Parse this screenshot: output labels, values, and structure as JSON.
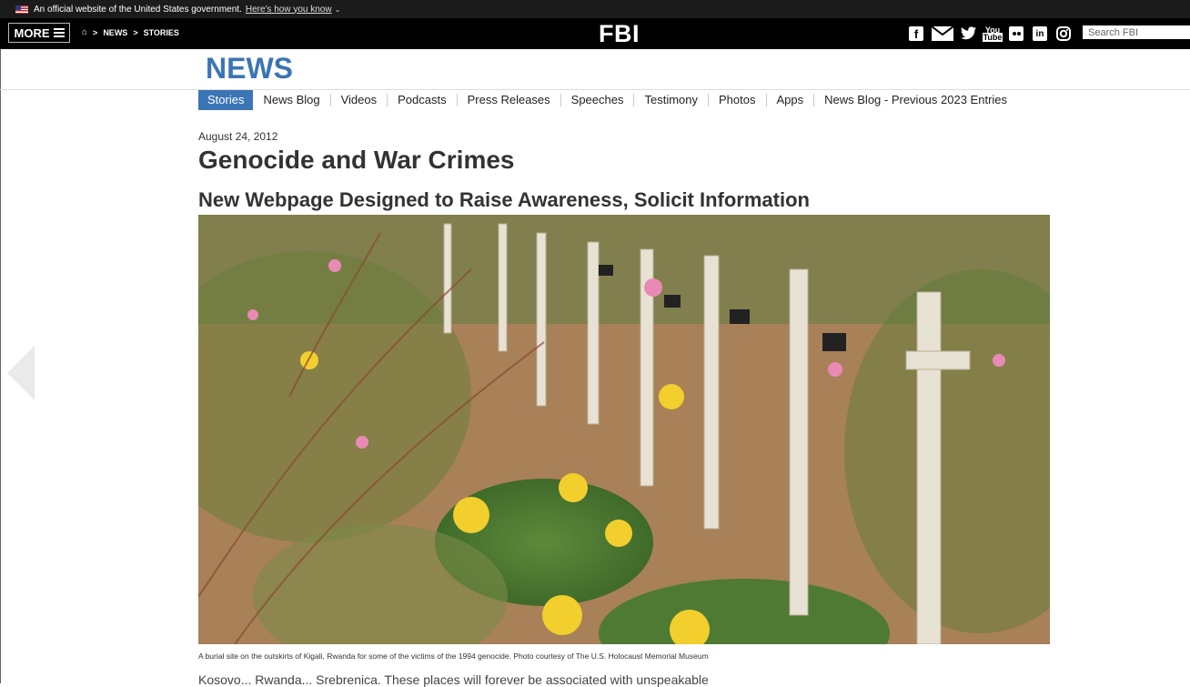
{
  "gov_banner": {
    "text": "An official website of the United States government.",
    "link": "Here's how you know"
  },
  "topbar": {
    "more_label": "MORE",
    "breadcrumb": [
      "NEWS",
      "STORIES"
    ],
    "logo": "FBI",
    "social_icons": [
      "facebook-icon",
      "email-icon",
      "twitter-icon",
      "youtube-icon",
      "flickr-icon",
      "linkedin-icon",
      "instagram-icon"
    ],
    "search_placeholder": "Search FBI"
  },
  "section": {
    "title": "NEWS"
  },
  "subnav": {
    "tabs": [
      "Stories",
      "News Blog",
      "Videos",
      "Podcasts",
      "Press Releases",
      "Speeches",
      "Testimony",
      "Photos",
      "Apps",
      "News Blog - Previous 2023 Entries"
    ],
    "active": "Stories"
  },
  "article": {
    "date": "August 24, 2012",
    "title": "Genocide and War Crimes",
    "subtitle": "New Webpage Designed to Raise Awareness, Solicit Information",
    "caption": "A burial site on the outskirts of Kigali, Rwanda for some of the victims of the 1994 genocide. Photo courtesy of The U.S. Holocaust Memorial Museum",
    "body_start": "Kosovo... Rwanda... Srebrenica. These places will forever be associated with unspeakable"
  },
  "colors": {
    "accent": "#3b75b5",
    "topbar": "#000000",
    "gov_banner": "#1b1b1b"
  }
}
